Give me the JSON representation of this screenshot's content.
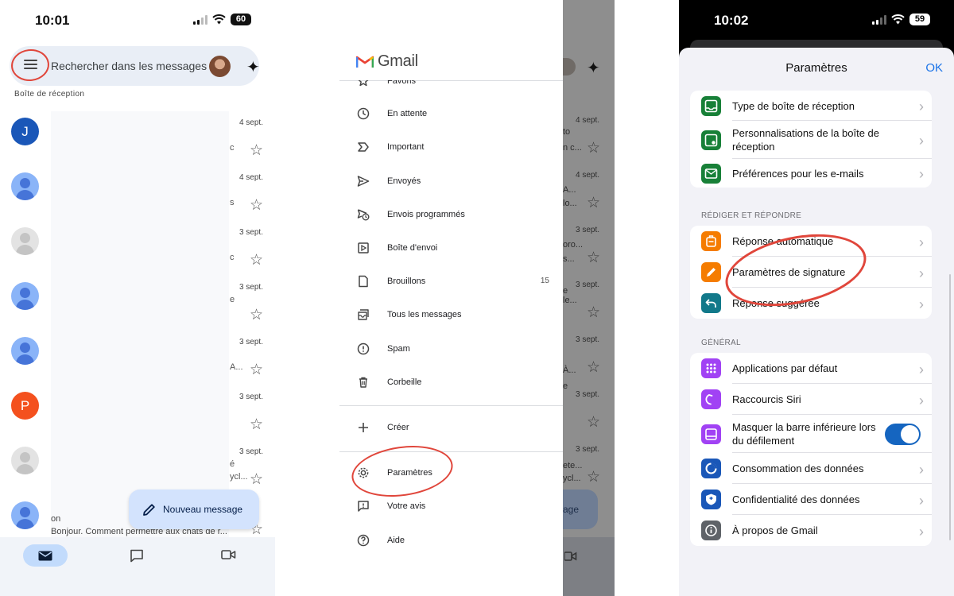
{
  "panel1": {
    "status": {
      "time": "10:01",
      "battery": "60"
    },
    "search": {
      "placeholder": "Rechercher dans les messages"
    },
    "inbox_label": "Boîte de réception",
    "emails": [
      {
        "avatar_letter": "J",
        "avatar_color": "#1a57b8",
        "date": "4 sept.",
        "frag1": "",
        "frag2": "c"
      },
      {
        "avatar_letter": "",
        "avatar_color": "#8ab4f8",
        "date": "4 sept.",
        "frag1": "",
        "frag2": "s"
      },
      {
        "avatar_letter": "",
        "avatar_color": "#e3e3e3",
        "date": "3 sept.",
        "frag1": "",
        "frag2": "c"
      },
      {
        "avatar_letter": "",
        "avatar_color": "#8ab4f8",
        "date": "3 sept.",
        "frag1": "e",
        "frag2": ""
      },
      {
        "avatar_letter": "",
        "avatar_color": "#8ab4f8",
        "date": "3 sept.",
        "frag1": "",
        "frag2": "A..."
      },
      {
        "avatar_letter": "P",
        "avatar_color": "#f4511e",
        "date": "3 sept.",
        "frag1": "",
        "frag2": ""
      },
      {
        "avatar_letter": "",
        "avatar_color": "#e3e3e3",
        "date": "3 sept.",
        "frag1": "é",
        "frag2": "ycl..."
      },
      {
        "avatar_letter": "",
        "avatar_color": "#8ab4f8",
        "date": "",
        "frag1": "",
        "frag2": ""
      }
    ],
    "snippet_partial": "on",
    "snippet": "Bonjour. Comment permettre aux chats de r...",
    "fab_label": "Nouveau message"
  },
  "panel2": {
    "logo_text": "Gmail",
    "items": [
      {
        "label": "Favoris",
        "count": ""
      },
      {
        "label": "En attente",
        "count": ""
      },
      {
        "label": "Important",
        "count": ""
      },
      {
        "label": "Envoyés",
        "count": ""
      },
      {
        "label": "Envois programmés",
        "count": ""
      },
      {
        "label": "Boîte d'envoi",
        "count": ""
      },
      {
        "label": "Brouillons",
        "count": "15"
      },
      {
        "label": "Tous les messages",
        "count": ""
      },
      {
        "label": "Spam",
        "count": ""
      },
      {
        "label": "Corbeille",
        "count": ""
      }
    ],
    "create_label": "Créer",
    "settings_label": "Paramètres",
    "feedback_label": "Votre avis",
    "help_label": "Aide",
    "shade": {
      "dates": [
        "4 sept.",
        "4 sept.",
        "3 sept.",
        "3 sept.",
        "3 sept.",
        "3 sept.",
        "3 sept."
      ],
      "frags": [
        "to",
        "n c...",
        "A...",
        "lo...",
        "oro...",
        "s...",
        "e",
        "le...",
        "À...",
        "À...",
        "e",
        "ete...",
        "ycl..."
      ],
      "fab_partial": "age"
    }
  },
  "panel3": {
    "status": {
      "time": "10:02",
      "battery": "59"
    },
    "title": "Paramètres",
    "ok_label": "OK",
    "group1": [
      {
        "label": "Type de boîte de réception",
        "icon": "inbox-icon",
        "color": "#188038"
      },
      {
        "label": "Personnalisations de la boîte de réception",
        "icon": "inbox-custom-icon",
        "color": "#188038"
      },
      {
        "label": "Préférences pour les e-mails",
        "icon": "mail-icon",
        "color": "#188038"
      }
    ],
    "section2": "RÉDIGER ET RÉPONDRE",
    "group2": [
      {
        "label": "Réponse automatique",
        "icon": "suitcase-icon",
        "color": "#f57c00"
      },
      {
        "label": "Paramètres de signature",
        "icon": "pen-icon",
        "color": "#f57c00"
      },
      {
        "label": "Réponse suggérée",
        "icon": "reply-icon",
        "color": "#12798a"
      }
    ],
    "section3": "GÉNÉRAL",
    "group3": [
      {
        "label": "Applications par défaut",
        "icon": "apps-grid-icon",
        "color": "#a142f4"
      },
      {
        "label": "Raccourcis Siri",
        "icon": "siri-icon",
        "color": "#a142f4"
      },
      {
        "label": "Masquer la barre inférieure lors du défilement",
        "icon": "bottom-bar-icon",
        "color": "#a142f4",
        "toggle": true
      },
      {
        "label": "Consommation des données",
        "icon": "data-icon",
        "color": "#1a57b8"
      },
      {
        "label": "Confidentialité des données",
        "icon": "shield-icon",
        "color": "#1a57b8"
      },
      {
        "label": "À propos de Gmail",
        "icon": "info-icon",
        "color": "#5f6368"
      }
    ]
  }
}
